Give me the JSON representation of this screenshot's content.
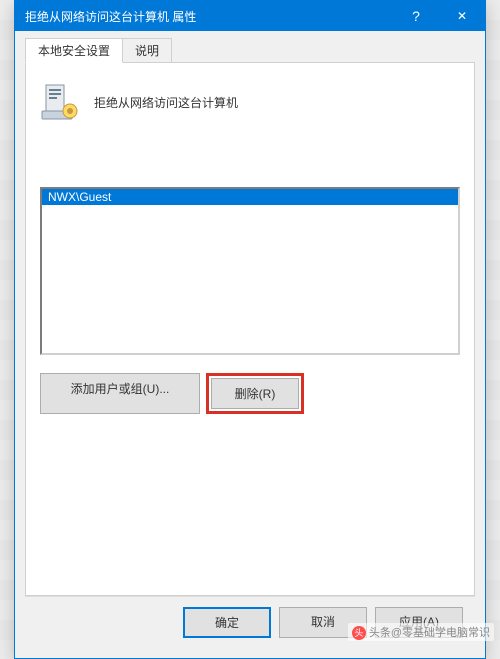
{
  "titlebar": {
    "title": "拒绝从网络访问这台计算机 属性",
    "help_symbol": "?",
    "close_symbol": "✕"
  },
  "tabs": {
    "tab1_label": "本地安全设置",
    "tab2_label": "说明"
  },
  "panel": {
    "header_text": "拒绝从网络访问这台计算机",
    "list_items": [
      "NWX\\Guest"
    ]
  },
  "buttons": {
    "add_label": "添加用户或组(U)...",
    "remove_label": "删除(R)",
    "ok_label": "确定",
    "cancel_label": "取消",
    "apply_label": "应用(A)"
  },
  "watermark": {
    "prefix": "头条",
    "text": "@零基础学电脑常识"
  }
}
